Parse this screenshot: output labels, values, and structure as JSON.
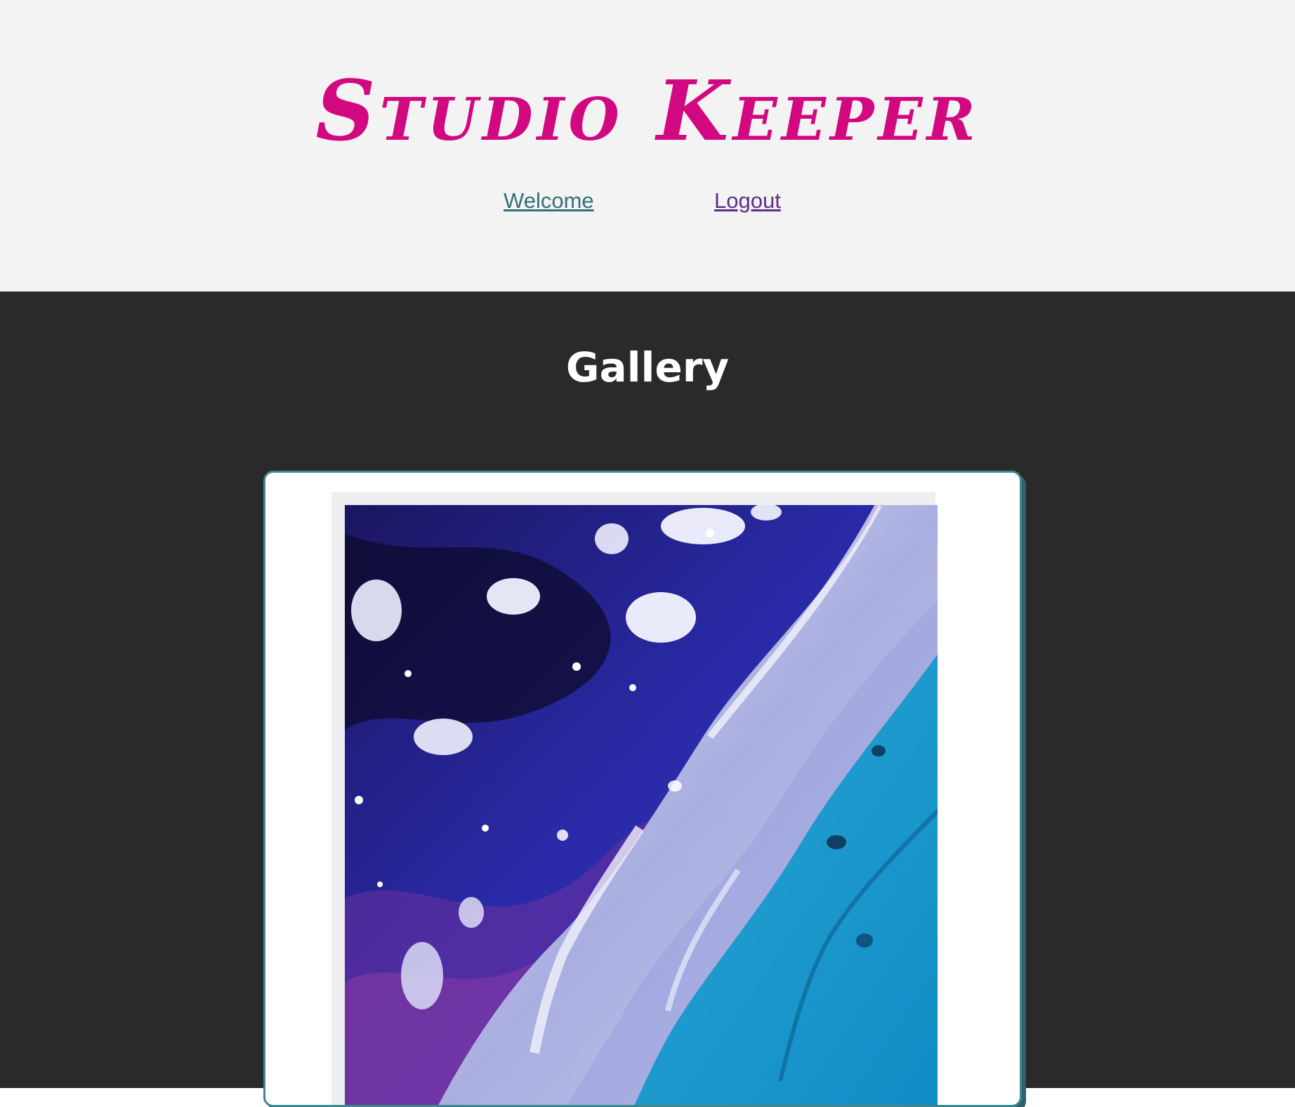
{
  "brand": {
    "title": "Studio Keeper",
    "color": "#d1087f"
  },
  "nav": {
    "items": [
      {
        "label": "Welcome"
      },
      {
        "label": "Logout"
      }
    ]
  },
  "main": {
    "title": "Gallery"
  },
  "gallery": {
    "items": [
      {
        "image": "abstract fluid art painting in blue, purple and white"
      }
    ]
  }
}
